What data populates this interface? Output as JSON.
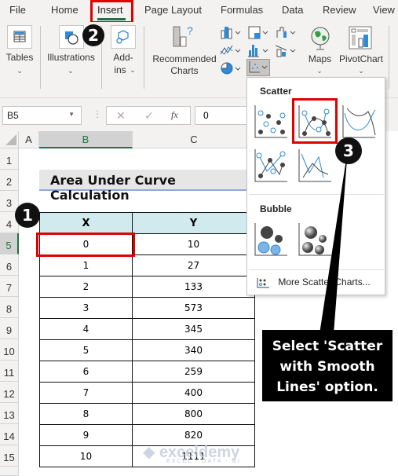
{
  "ribbon_tabs": [
    {
      "label": "File"
    },
    {
      "label": "Home"
    },
    {
      "label": "Insert",
      "active": true
    },
    {
      "label": "Page Layout"
    },
    {
      "label": "Formulas"
    },
    {
      "label": "Data"
    },
    {
      "label": "Review"
    },
    {
      "label": "View"
    }
  ],
  "ribbon": {
    "tables": "Tables",
    "illustrations": "Illustrations",
    "addins_1": "Add-",
    "addins_2": "ins",
    "recommended_1": "Recommended",
    "recommended_2": "Charts",
    "maps": "Maps",
    "pivotchart": "PivotChart",
    "chevron": "⌄"
  },
  "formula_bar": {
    "name_box": "B5",
    "fx": "fx",
    "cancel": "✕",
    "enter": "✓",
    "value": "0"
  },
  "columns": [
    "A",
    "B",
    "C"
  ],
  "rows": [
    "1",
    "2",
    "3",
    "4",
    "5",
    "6",
    "7",
    "8",
    "9",
    "10",
    "11",
    "12",
    "13",
    "14",
    "15"
  ],
  "sheet": {
    "title": "Area Under Curve Calculation",
    "headers": {
      "x": "X",
      "y": "Y"
    },
    "data": [
      {
        "x": "0",
        "y": "10"
      },
      {
        "x": "1",
        "y": "27"
      },
      {
        "x": "2",
        "y": "133"
      },
      {
        "x": "3",
        "y": "573"
      },
      {
        "x": "4",
        "y": "345"
      },
      {
        "x": "5",
        "y": "340"
      },
      {
        "x": "6",
        "y": "259"
      },
      {
        "x": "7",
        "y": "400"
      },
      {
        "x": "8",
        "y": "800"
      },
      {
        "x": "9",
        "y": "820"
      },
      {
        "x": "10",
        "y": "1111"
      }
    ]
  },
  "dropdown": {
    "scatter_heading": "Scatter",
    "bubble_heading": "Bubble",
    "more": "More Scatter Charts...",
    "options": [
      "Scatter",
      "Scatter with Smooth Lines and Markers",
      "Scatter with Smooth Lines",
      "Scatter with Straight Lines and Markers",
      "Scatter with Straight Lines",
      "Bubble",
      "3-D Bubble"
    ]
  },
  "annotations": {
    "step1": "1",
    "step2": "2",
    "step3": "3",
    "callout": "Select 'Scatter with Smooth Lines' option."
  },
  "watermark": {
    "name": "exceldemy",
    "tagline": "EXCEL · DATA · BI"
  },
  "colors": {
    "accent": "#217346",
    "highlight": "#e00000",
    "header_fill": "#d0eaed",
    "series_blue": "#2e8bd8"
  }
}
